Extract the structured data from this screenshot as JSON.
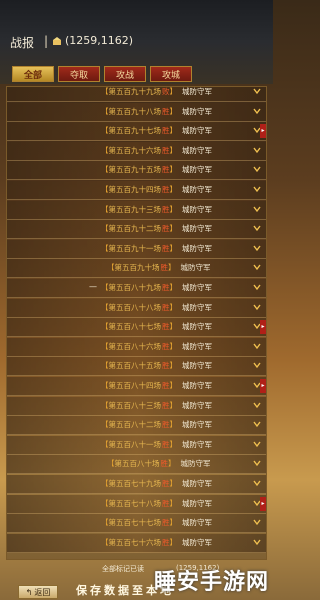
{
  "header": {
    "title": "战报",
    "separator": "|",
    "coords": "(1259,1162)"
  },
  "tabs": [
    {
      "label": "全部",
      "active": true
    },
    {
      "label": "夺取",
      "active": false
    },
    {
      "label": "攻战",
      "active": false
    },
    {
      "label": "攻城",
      "active": false
    }
  ],
  "rows": [
    {
      "battle": "第五百九十九场",
      "result": "败",
      "defender": "城防守军"
    },
    {
      "battle": "第五百九十八场",
      "result": "胜",
      "defender": "城防守军"
    },
    {
      "battle": "第五百九十七场",
      "result": "胜",
      "defender": "城防守军"
    },
    {
      "battle": "第五百九十六场",
      "result": "胜",
      "defender": "城防守军"
    },
    {
      "battle": "第五百九十五场",
      "result": "胜",
      "defender": "城防守军"
    },
    {
      "battle": "第五百九十四场",
      "result": "胜",
      "defender": "城防守军"
    },
    {
      "battle": "第五百九十三场",
      "result": "胜",
      "defender": "城防守军"
    },
    {
      "battle": "第五百九十二场",
      "result": "胜",
      "defender": "城防守军"
    },
    {
      "battle": "第五百九十一场",
      "result": "胜",
      "defender": "城防守军"
    },
    {
      "battle": "第五百九十场",
      "result": "胜",
      "defender": "城防守军"
    },
    {
      "battle": "第五百八十九场",
      "result": "胜",
      "defender": "城防守军"
    },
    {
      "battle": "第五百八十八场",
      "result": "胜",
      "defender": "城防守军"
    },
    {
      "battle": "第五百八十七场",
      "result": "胜",
      "defender": "城防守军"
    },
    {
      "battle": "第五百八十六场",
      "result": "胜",
      "defender": "城防守军"
    },
    {
      "battle": "第五百八十五场",
      "result": "胜",
      "defender": "城防守军"
    },
    {
      "battle": "第五百八十四场",
      "result": "胜",
      "defender": "城防守军"
    },
    {
      "battle": "第五百八十三场",
      "result": "胜",
      "defender": "城防守军"
    },
    {
      "battle": "第五百八十二场",
      "result": "胜",
      "defender": "城防守军"
    },
    {
      "battle": "第五百八十一场",
      "result": "胜",
      "defender": "城防守军"
    },
    {
      "battle": "第五百八十场",
      "result": "胜",
      "defender": "城防守军"
    },
    {
      "battle": "第五百七十九场",
      "result": "胜",
      "defender": "城防守军"
    },
    {
      "battle": "第五百七十八场",
      "result": "胜",
      "defender": "城防守军"
    },
    {
      "battle": "第五百七十七场",
      "result": "胜",
      "defender": "城防守军"
    },
    {
      "battle": "第五百七十六场",
      "result": "胜",
      "defender": "城防守军"
    }
  ],
  "footer": {
    "marked_label": "全部标记已读",
    "marked_coords": "(1259,1162)",
    "save_label": "保存数据至本地",
    "back_label": "返回"
  },
  "watermark": "睡安手游网"
}
